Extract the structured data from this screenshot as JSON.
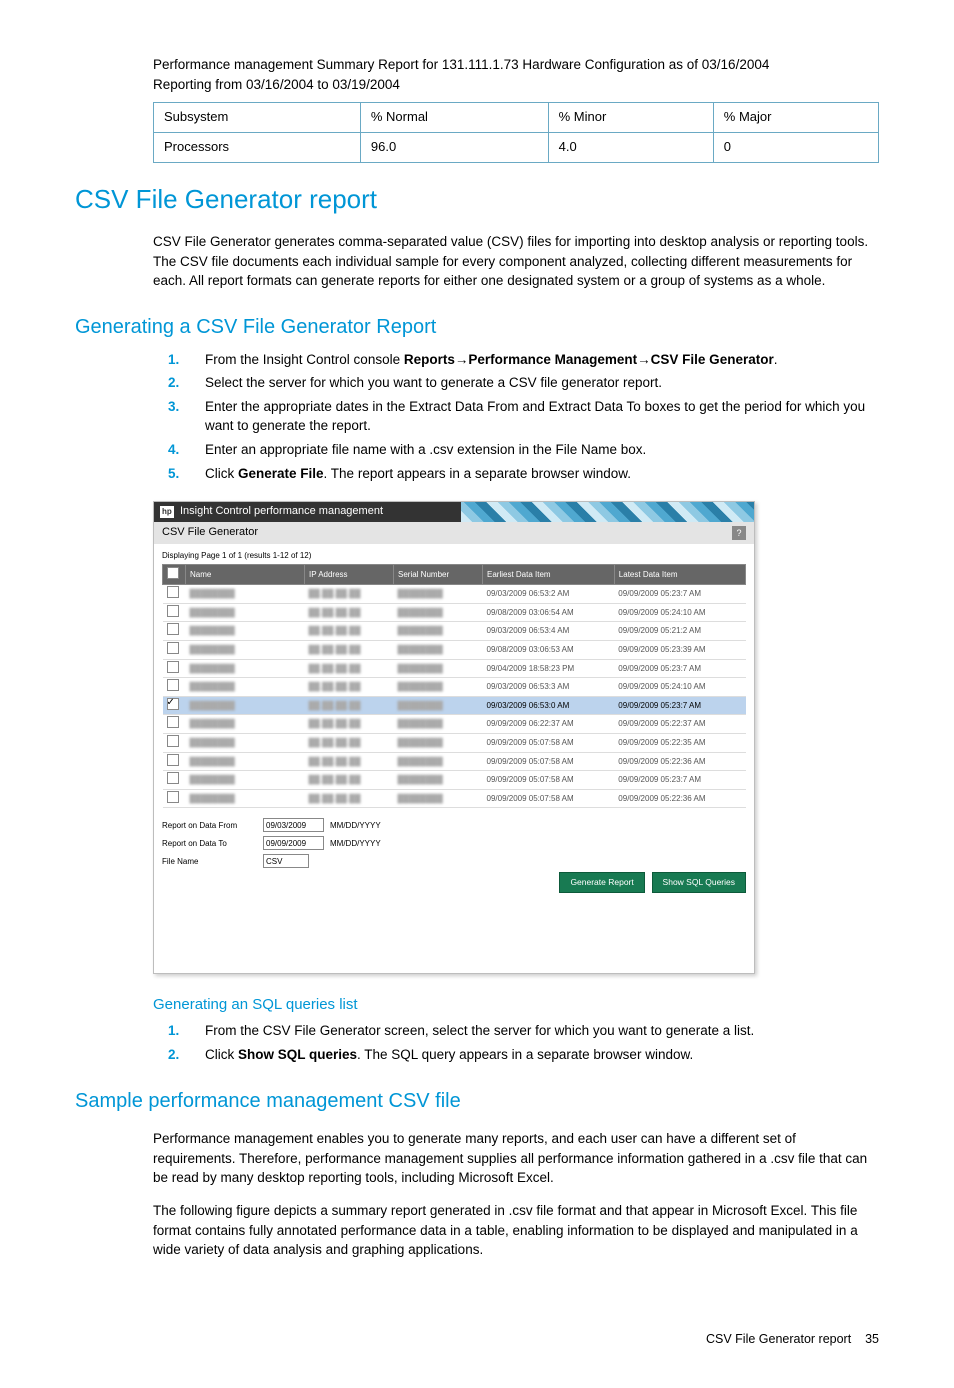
{
  "intro": {
    "line1": "Performance management Summary Report for 131.111.1.73 Hardware Configuration as of 03/16/2004",
    "line2": "Reporting from 03/16/2004 to 03/19/2004"
  },
  "summary_table": {
    "headers": [
      "Subsystem",
      "% Normal",
      "% Minor",
      "% Major"
    ],
    "row": [
      "Processors",
      "96.0",
      "4.0",
      "0"
    ]
  },
  "h1": "CSV File Generator report",
  "p1": "CSV File Generator generates comma-separated value (CSV) files for importing into desktop analysis or reporting tools. The CSV file documents each individual sample for every component analyzed, collecting different measurements for each. All report formats can generate reports for either one designated system or a group of systems as a whole.",
  "h2a": "Generating a CSV File Generator Report",
  "steps1": {
    "s1a": "From the Insight Control console ",
    "s1b": "Reports",
    "s1c": "Performance Management",
    "s1d": "CSV File Generator",
    "s2": "Select the server for which you want to generate a CSV file generator report.",
    "s3": "Enter the appropriate dates in the Extract Data From and Extract Data To boxes to get the period for which you want to generate the report.",
    "s4": "Enter an appropriate file name with a .csv extension in the File Name box.",
    "s5a": "Click ",
    "s5b": "Generate File",
    "s5c": ". The report appears in a separate browser window."
  },
  "figure": {
    "app_title": "Insight Control performance management",
    "panel_title": "CSV File Generator",
    "paging": "Displaying Page 1 of 1 (results 1-12 of 12)",
    "cols": [
      "",
      "Name",
      "IP Address",
      "Serial Number",
      "Earliest Data Item",
      "Latest Data Item"
    ],
    "rows": [
      {
        "checked": false,
        "earliest": "09/03/2009 06:53:2 AM",
        "latest": "09/09/2009 05:23:7 AM"
      },
      {
        "checked": false,
        "earliest": "09/08/2009 03:06:54 AM",
        "latest": "09/09/2009 05:24:10 AM"
      },
      {
        "checked": false,
        "earliest": "09/03/2009 06:53:4 AM",
        "latest": "09/09/2009 05:21:2 AM"
      },
      {
        "checked": false,
        "earliest": "09/08/2009 03:06:53 AM",
        "latest": "09/09/2009 05:23:39 AM"
      },
      {
        "checked": false,
        "earliest": "09/04/2009 18:58:23 PM",
        "latest": "09/09/2009 05:23:7 AM"
      },
      {
        "checked": false,
        "earliest": "09/03/2009 06:53:3 AM",
        "latest": "09/09/2009 05:24:10 AM"
      },
      {
        "checked": true,
        "earliest": "09/03/2009 06:53:0 AM",
        "latest": "09/09/2009 05:23:7 AM",
        "highlight": true
      },
      {
        "checked": false,
        "earliest": "09/09/2009 06:22:37 AM",
        "latest": "09/09/2009 05:22:37 AM"
      },
      {
        "checked": false,
        "earliest": "09/09/2009 05:07:58 AM",
        "latest": "09/09/2009 05:22:35 AM"
      },
      {
        "checked": false,
        "earliest": "09/09/2009 05:07:58 AM",
        "latest": "09/09/2009 05:22:36 AM"
      },
      {
        "checked": false,
        "earliest": "09/09/2009 05:07:58 AM",
        "latest": "09/09/2009 05:23:7 AM"
      },
      {
        "checked": false,
        "earliest": "09/09/2009 05:07:58 AM",
        "latest": "09/09/2009 05:22:36 AM"
      }
    ],
    "from_label": "Report on Data From",
    "to_label": "Report on Data To",
    "file_label": "File Name",
    "from_val": "09/03/2009",
    "to_val": "09/09/2009",
    "file_val": "CSV",
    "hint": "MM/DD/YYYY",
    "btn_generate": "Generate Report",
    "btn_sql": "Show SQL Queries"
  },
  "h3a": "Generating an SQL queries list",
  "steps2": {
    "s1": "From the CSV File Generator screen, select the server for which you want to generate a list.",
    "s2a": "Click ",
    "s2b": "Show SQL queries",
    "s2c": ". The SQL query appears in a separate browser window."
  },
  "h2b": "Sample performance management CSV file",
  "p2": "Performance management enables you to generate many reports, and each user can have a different set of requirements. Therefore, performance management supplies all performance information gathered in a .csv file that can be read by many desktop reporting tools, including Microsoft Excel.",
  "p3": "The following figure depicts a summary report generated in .csv file format and that appear in Microsoft Excel. This file format contains fully annotated performance data in a table, enabling information to be displayed and manipulated in a wide variety of data analysis and graphing applications.",
  "footer": {
    "text": "CSV File Generator report",
    "page": "35"
  }
}
